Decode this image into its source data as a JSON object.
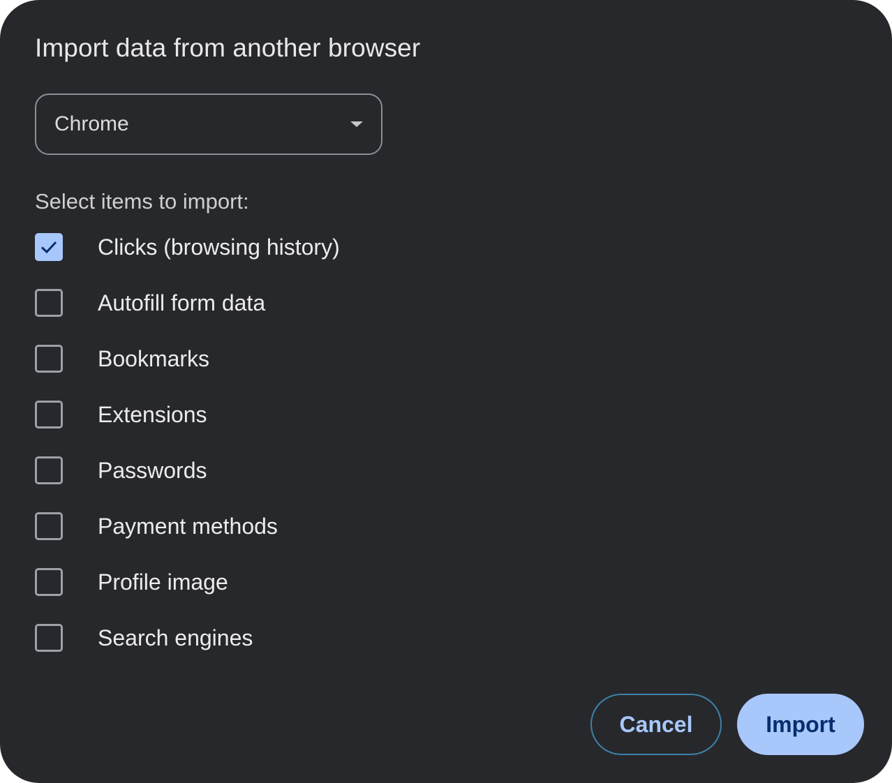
{
  "dialog": {
    "title": "Import data from another browser",
    "browser_select": {
      "value": "Chrome"
    },
    "section_label": "Select items to import:",
    "items": [
      {
        "label": "Clicks (browsing history)",
        "checked": true
      },
      {
        "label": "Autofill form data",
        "checked": false
      },
      {
        "label": "Bookmarks",
        "checked": false
      },
      {
        "label": "Extensions",
        "checked": false
      },
      {
        "label": "Passwords",
        "checked": false
      },
      {
        "label": "Payment methods",
        "checked": false
      },
      {
        "label": "Profile image",
        "checked": false
      },
      {
        "label": "Search engines",
        "checked": false
      }
    ],
    "buttons": {
      "cancel_label": "Cancel",
      "import_label": "Import"
    }
  },
  "colors": {
    "background": "#27282c",
    "accent": "#a8c7fa",
    "checkmark": "#062e6f"
  },
  "icons": {
    "dropdown": "chevron-down-icon",
    "check": "checkmark-icon"
  }
}
